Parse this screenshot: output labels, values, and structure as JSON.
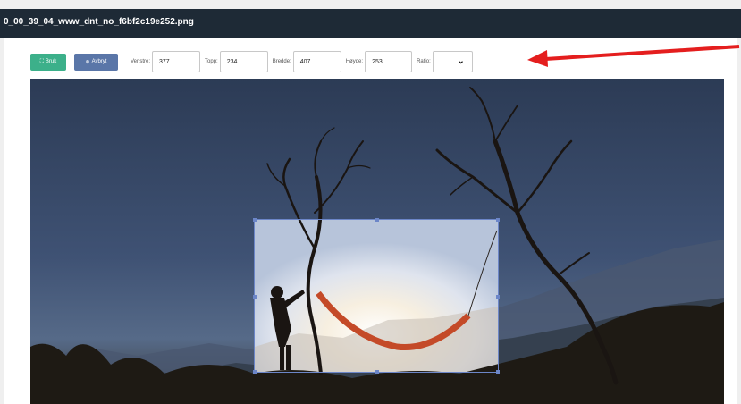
{
  "window": {
    "title": "0_00_39_04_www_dnt_no_f6bf2c19e252.png"
  },
  "toolbar": {
    "use_button": {
      "icon": "crop-icon",
      "label": "Bruk"
    },
    "cancel_button": {
      "icon": "cancel-circle-icon",
      "label": "Avbryt"
    },
    "left_label": "Venstre:",
    "left_value": "377",
    "top_label": "Topp:",
    "top_value": "234",
    "width_label": "Bredde:",
    "width_value": "407",
    "height_label": "Høyde:",
    "height_value": "253",
    "ratio_label": "Ratio:",
    "ratio_value": ""
  },
  "annotation": {
    "arrow_color": "#e41e1e"
  },
  "colors": {
    "titlebar": "#1e2a36",
    "use_button": "#3cb08a",
    "cancel_button": "#5a76a8",
    "crop_border": "#6c86c8"
  }
}
